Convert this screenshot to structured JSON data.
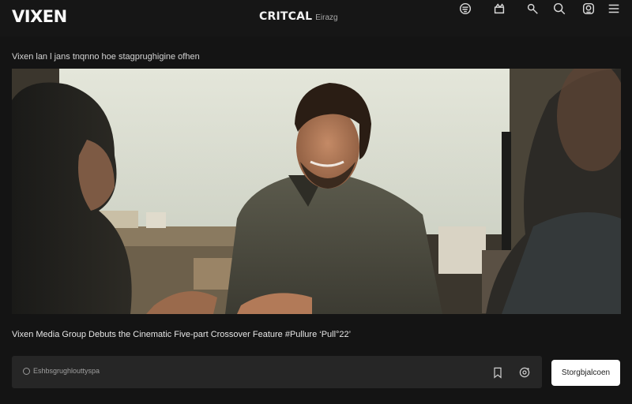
{
  "header": {
    "logo": "VIXEN",
    "brand_name": "CRITCAL",
    "brand_sub": "Eirazg",
    "icons": [
      "logo-s-icon",
      "clapper-icon",
      "wrench-icon",
      "search-icon",
      "badge-icon",
      "menu-icon"
    ]
  },
  "top_caption": "Vixen lan l jans tnqnno hoe stagprughigine ofhen",
  "video": {
    "description_only": true
  },
  "headline": "Vixen Media Group Debuts the Cinematic Five-part Crossover Feature #Pullure ‘Pull°22’",
  "comment_bar": {
    "placeholder": "Eshbsgrughlouttyspa",
    "icons": [
      "bookmark-icon",
      "share-comment-icon"
    ]
  },
  "action_button": "Storgbjalcoen",
  "colors": {
    "background": "#141414",
    "bar": "#262626",
    "button": "#ffffff"
  }
}
